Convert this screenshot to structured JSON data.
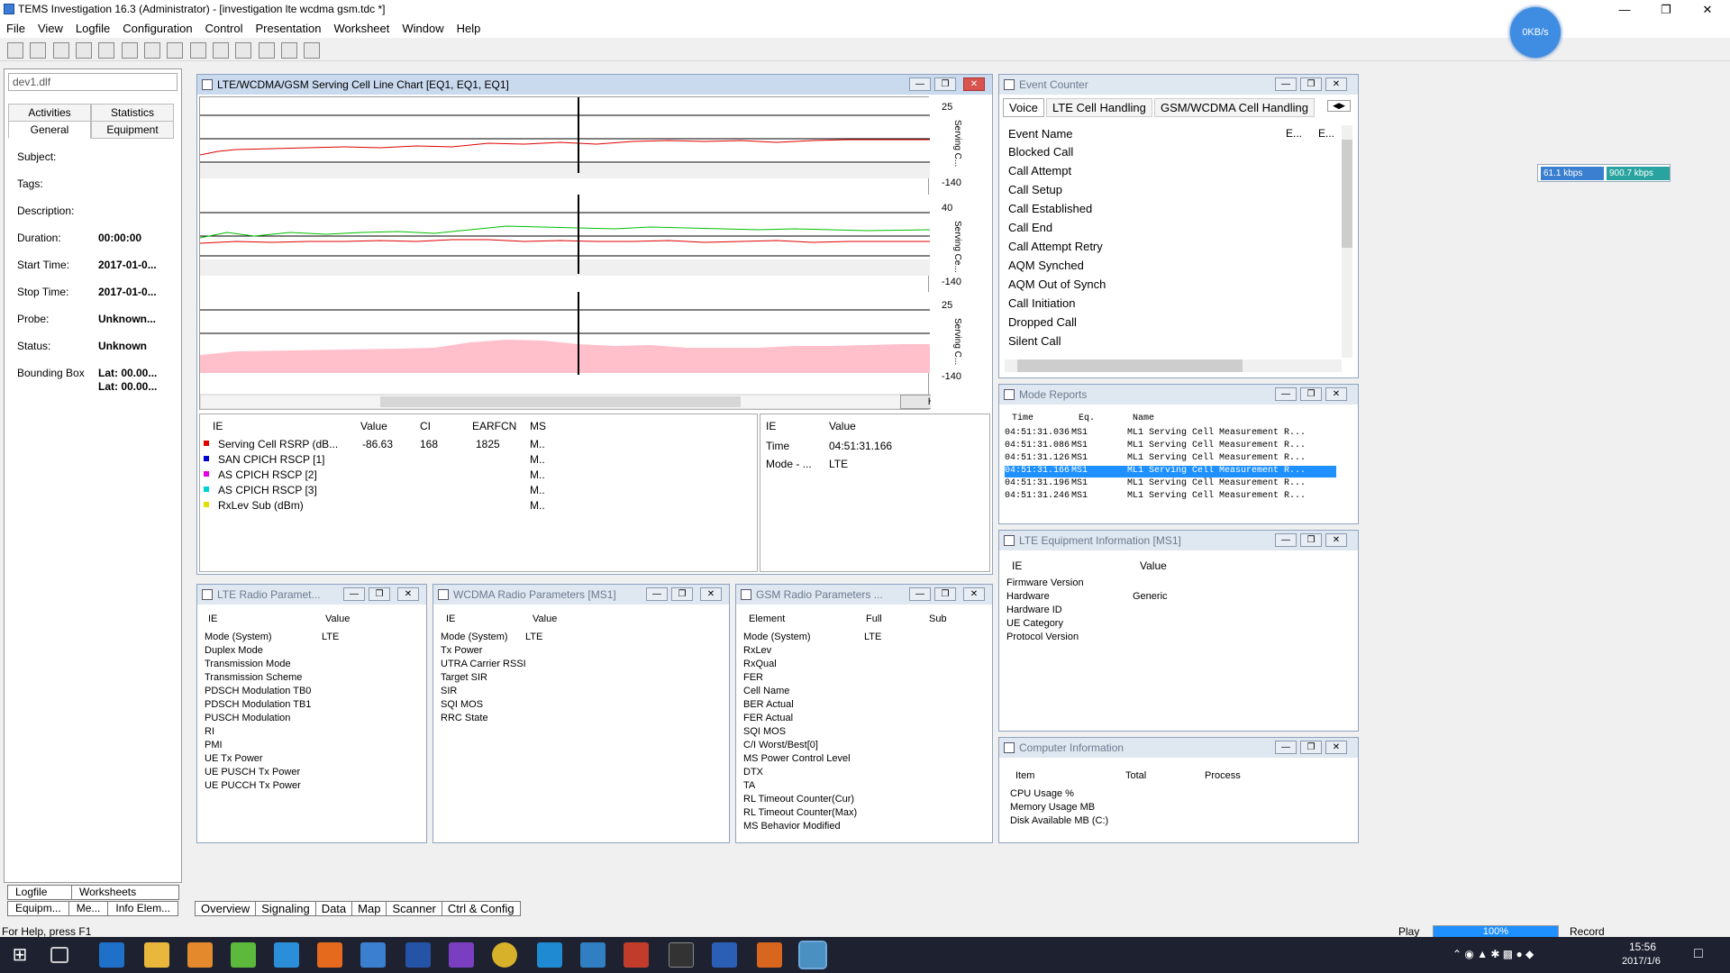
{
  "app": {
    "title": "TEMS Investigation 16.3 (Administrator) - [investigation lte wcdma gsm.tdc *]"
  },
  "menu": [
    "File",
    "View",
    "Logfile",
    "Configuration",
    "Control",
    "Presentation",
    "Worksheet",
    "Window",
    "Help"
  ],
  "net": {
    "bubble": "0KB/s",
    "down": "61.1 kbps",
    "up": "900.7 kbps"
  },
  "left": {
    "file": "dev1.dlf",
    "tabs_top": [
      "Activities",
      "Statistics"
    ],
    "tabs_bottom": [
      "General",
      "Equipment"
    ],
    "rows": [
      {
        "label": "Subject:",
        "value": ""
      },
      {
        "label": "Tags:",
        "value": ""
      },
      {
        "label": "Description:",
        "value": ""
      },
      {
        "label": "Duration:",
        "value": "00:00:00"
      },
      {
        "label": "Start Time:",
        "value": "2017-01-0..."
      },
      {
        "label": "Stop Time:",
        "value": "2017-01-0..."
      },
      {
        "label": "Probe:",
        "value": "Unknown..."
      },
      {
        "label": "Status:",
        "value": "Unknown"
      },
      {
        "label": "Bounding Box",
        "value": "Lat: 00.00..."
      },
      {
        "label": "",
        "value": "Lat: 00.00..."
      }
    ],
    "bottom_tabs_1": [
      "Logfile",
      "Worksheets"
    ],
    "bottom_tabs_2": [
      "Equipm...",
      "Me...",
      "Info Elem..."
    ]
  },
  "chart": {
    "title": "LTE/WCDMA/GSM Serving Cell Line Chart [EQ1, EQ1, EQ1]",
    "panels": [
      {
        "ymax": "25",
        "ymin": "-140",
        "label": "Serving C..."
      },
      {
        "ymax": "40",
        "ymin": "-140",
        "label": "Serving Ce..."
      },
      {
        "ymax": "25",
        "ymin": "-140",
        "label": "Serving C..."
      }
    ],
    "hold": "Hold",
    "legend_headers": [
      "IE",
      "Value",
      "CI",
      "EARFCN",
      "MS"
    ],
    "legend": [
      {
        "color": "#e00000",
        "ie": "Serving Cell RSRP (dB...",
        "value": "-86.63",
        "ci": "168",
        "earfcn": "1825",
        "ms": "M.."
      },
      {
        "color": "#0000d0",
        "ie": "SAN CPICH RSCP [1]",
        "value": "",
        "ci": "",
        "earfcn": "",
        "ms": "M.."
      },
      {
        "color": "#e000e0",
        "ie": "AS CPICH RSCP [2]",
        "value": "",
        "ci": "",
        "earfcn": "",
        "ms": "M.."
      },
      {
        "color": "#00d0d0",
        "ie": "AS CPICH RSCP [3]",
        "value": "",
        "ci": "",
        "earfcn": "",
        "ms": "M.."
      },
      {
        "color": "#e0e000",
        "ie": "RxLev Sub (dBm)",
        "value": "",
        "ci": "",
        "earfcn": "",
        "ms": "M.."
      }
    ],
    "info_headers": [
      "IE",
      "Value"
    ],
    "info": [
      {
        "ie": "Time",
        "value": "04:51:31.166"
      },
      {
        "ie": "Mode - ...",
        "value": "LTE"
      }
    ]
  },
  "event_counter": {
    "title": "Event Counter",
    "tabs": [
      "Voice",
      "LTE Cell Handling",
      "GSM/WCDMA Cell Handling"
    ],
    "headers": [
      "Event Name",
      "E...",
      "E..."
    ],
    "events": [
      "Blocked Call",
      "Call Attempt",
      "Call Setup",
      "Call Established",
      "Call End",
      "Call Attempt Retry",
      "AQM Synched",
      "AQM Out of Synch",
      "Call Initiation",
      "Dropped Call",
      "Silent Call"
    ]
  },
  "mode_reports": {
    "title": "Mode Reports",
    "headers": [
      "Time",
      "Eq.",
      "Name"
    ],
    "rows": [
      {
        "time": "04:51:31.036",
        "eq": "MS1",
        "name": "ML1 Serving Cell Measurement R..."
      },
      {
        "time": "04:51:31.086",
        "eq": "MS1",
        "name": "ML1 Serving Cell Measurement R..."
      },
      {
        "time": "04:51:31.126",
        "eq": "MS1",
        "name": "ML1 Serving Cell Measurement R..."
      },
      {
        "time": "04:51:31.166",
        "eq": "MS1",
        "name": "ML1 Serving Cell Measurement R..."
      },
      {
        "time": "04:51:31.196",
        "eq": "MS1",
        "name": "ML1 Serving Cell Measurement R..."
      },
      {
        "time": "04:51:31.246",
        "eq": "MS1",
        "name": "ML1 Serving Cell Measurement R..."
      }
    ]
  },
  "lte_equip": {
    "title": "LTE Equipment Information [MS1]",
    "headers": [
      "IE",
      "Value"
    ],
    "rows": [
      {
        "ie": "Firmware Version",
        "value": ""
      },
      {
        "ie": "Hardware",
        "value": "Generic"
      },
      {
        "ie": "Hardware ID",
        "value": ""
      },
      {
        "ie": "UE Category",
        "value": ""
      },
      {
        "ie": "Protocol Version",
        "value": ""
      }
    ]
  },
  "computer_info": {
    "title": "Computer Information",
    "headers": [
      "Item",
      "Total",
      "Process"
    ],
    "rows": [
      "CPU Usage %",
      "Memory Usage MB",
      "Disk Available MB (C:)"
    ]
  },
  "lte_radio": {
    "title": "LTE Radio Paramet...",
    "headers": [
      "IE",
      "Value"
    ],
    "rows": [
      {
        "ie": "Mode (System)",
        "value": "LTE"
      },
      {
        "ie": "Duplex Mode",
        "value": ""
      },
      {
        "ie": "Transmission Mode",
        "value": ""
      },
      {
        "ie": "Transmission Scheme",
        "value": ""
      },
      {
        "ie": "PDSCH Modulation TB0",
        "value": ""
      },
      {
        "ie": "PDSCH Modulation TB1",
        "value": ""
      },
      {
        "ie": "PUSCH Modulation",
        "value": ""
      },
      {
        "ie": "RI",
        "value": ""
      },
      {
        "ie": "PMI",
        "value": ""
      },
      {
        "ie": "UE Tx Power",
        "value": ""
      },
      {
        "ie": "UE PUSCH Tx Power",
        "value": ""
      },
      {
        "ie": "UE PUCCH Tx Power",
        "value": ""
      }
    ]
  },
  "wcdma_radio": {
    "title": "WCDMA Radio Parameters [MS1]",
    "headers": [
      "IE",
      "Value"
    ],
    "rows": [
      {
        "ie": "Mode (System)",
        "value": "LTE"
      },
      {
        "ie": "Tx Power",
        "value": ""
      },
      {
        "ie": "UTRA Carrier RSSI",
        "value": ""
      },
      {
        "ie": "Target SIR",
        "value": ""
      },
      {
        "ie": "SIR",
        "value": ""
      },
      {
        "ie": "SQI MOS",
        "value": ""
      },
      {
        "ie": "RRC State",
        "value": ""
      }
    ]
  },
  "gsm_radio": {
    "title": "GSM Radio Parameters ...",
    "headers": [
      "Element",
      "Full",
      "Sub"
    ],
    "rows": [
      {
        "ie": "Mode (System)",
        "value": "LTE"
      },
      {
        "ie": "RxLev",
        "value": ""
      },
      {
        "ie": "RxQual",
        "value": ""
      },
      {
        "ie": "FER",
        "value": ""
      },
      {
        "ie": "Cell Name",
        "value": ""
      },
      {
        "ie": "BER Actual",
        "value": ""
      },
      {
        "ie": "FER Actual",
        "value": ""
      },
      {
        "ie": "SQI MOS",
        "value": ""
      },
      {
        "ie": "C/I Worst/Best[0]",
        "value": ""
      },
      {
        "ie": "MS Power Control Level",
        "value": ""
      },
      {
        "ie": "DTX",
        "value": ""
      },
      {
        "ie": "TA",
        "value": ""
      },
      {
        "ie": "RL Timeout Counter(Cur)",
        "value": ""
      },
      {
        "ie": "RL Timeout Counter(Max)",
        "value": ""
      },
      {
        "ie": "MS Behavior Modified",
        "value": ""
      }
    ]
  },
  "sheet_tabs": [
    "Overview",
    "Signaling",
    "Data",
    "Map",
    "Scanner",
    "Ctrl & Config"
  ],
  "status": {
    "help": "For Help, press F1",
    "play": "Play",
    "progress": "100%",
    "progress_fraction": 1.0,
    "record": "Record"
  },
  "clock": {
    "time": "15:56",
    "date": "2017/1/6"
  }
}
